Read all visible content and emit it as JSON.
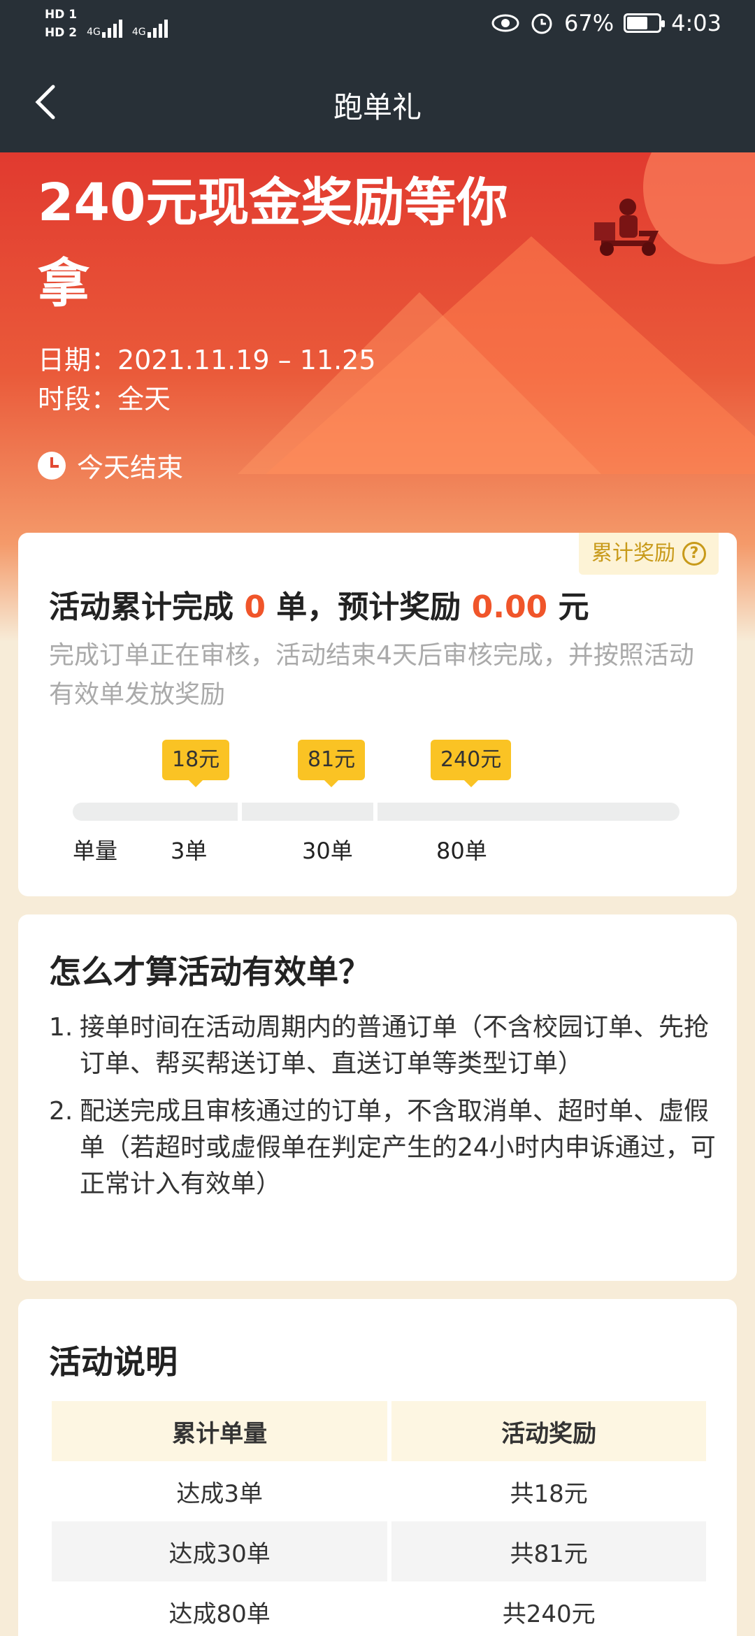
{
  "status_bar": {
    "hd1": "HD 1",
    "hd2": "HD 2",
    "net1": "4G",
    "net2": "4G",
    "battery": "67%",
    "time": "4:03"
  },
  "nav": {
    "title": "跑单礼"
  },
  "hero": {
    "title": "240元现金奖励等你拿",
    "date": "日期：2021.11.19 – 11.25",
    "slot": "时段：全天",
    "end": "今天结束"
  },
  "progress": {
    "reward_tag": "累计奖励",
    "title_prefix": "活动累计完成",
    "completed": "0",
    "title_unit": "单，预计奖励",
    "reward": "0.00",
    "reward_unit": "元",
    "note": "完成订单正在审核，活动结束4天后审核完成，并按照活动有效单发放奖励",
    "scale_label": "单量",
    "milestones": [
      {
        "orders": "3单",
        "reward": "18元"
      },
      {
        "orders": "30单",
        "reward": "81元"
      },
      {
        "orders": "80单",
        "reward": "240元"
      }
    ]
  },
  "valid": {
    "heading": "怎么才算活动有效单？",
    "rules": [
      {
        "num": "1.",
        "text": "接单时间在活动周期内的普通订单（不含校园订单、先抢订单、帮买帮送订单、直送订单等类型订单）"
      },
      {
        "num": "2.",
        "text": "配送完成且审核通过的订单，不含取消单、超时单、虚假单（若超时或虚假单在判定产生的24小时内申诉通过，可正常计入有效单）"
      }
    ]
  },
  "explain": {
    "heading": "活动说明",
    "col1": "累计单量",
    "col2": "活动奖励",
    "rows": [
      {
        "orders": "达成3单",
        "reward": "共18元"
      },
      {
        "orders": "达成30单",
        "reward": "共81元"
      },
      {
        "orders": "达成80单",
        "reward": "共240元"
      }
    ]
  }
}
